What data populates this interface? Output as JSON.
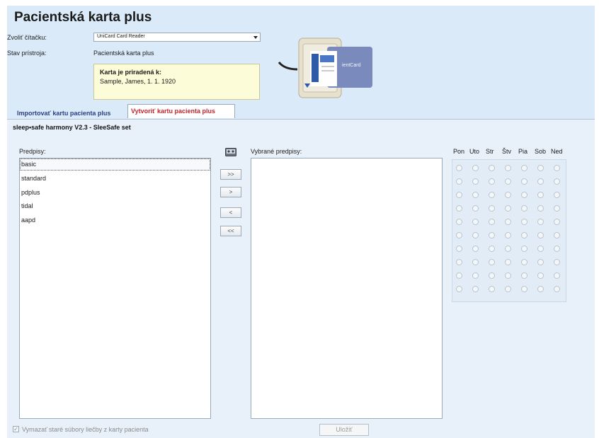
{
  "title": "Pacientská karta plus",
  "reader": {
    "label": "Zvoliť čítačku:",
    "value": "UniCard Card Reader"
  },
  "device_status": {
    "label": "Stav prístroja:",
    "value": "Pacientská karta plus"
  },
  "assignment": {
    "heading": "Karta je priradená k:",
    "value": "Sample, James, 1. 1. 1920"
  },
  "card_image": {
    "icon": "card-reader-image",
    "card_text_a": "ientCard"
  },
  "tabs": [
    {
      "label": "Importovať kartu pacienta plus",
      "active": false
    },
    {
      "label": "Vytvoriť kartu pacienta plus",
      "active": true
    }
  ],
  "subtitle": "sleep•safe harmony V2.3 - SleeSafe set",
  "prescriptions": {
    "label": "Predpisy:",
    "items": [
      "basic",
      "standard",
      "pdplus",
      "tidal",
      "aapd"
    ],
    "selected": "basic"
  },
  "transfer_buttons": {
    "add_all": ">>",
    "add": ">",
    "remove": "<",
    "remove_all": "<<"
  },
  "selected_prescriptions": {
    "label": "Vybrané predpisy:",
    "items": []
  },
  "days": [
    "Pon",
    "Uto",
    "Str",
    "Štv",
    "Pia",
    "Sob",
    "Ned"
  ],
  "day_rows": 10,
  "erase_checkbox": {
    "label": "Vymazať staré súbory liečby z karty pacienta",
    "checked": true
  },
  "save_button": "Uložiť",
  "colors": {
    "background": "#daeaf8",
    "active_tab": "#c0262d",
    "inactive_tab": "#2b3f85",
    "info_box": "#fcfcd9"
  }
}
